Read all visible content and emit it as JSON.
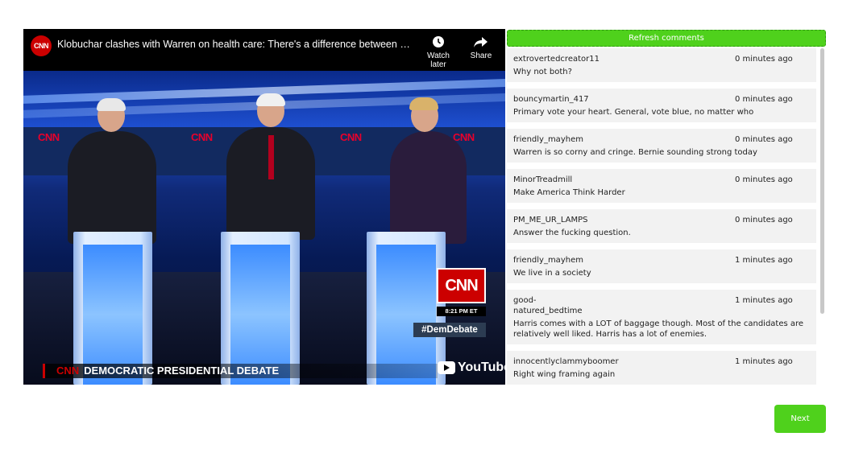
{
  "video": {
    "channel_logo": "CNN",
    "title": "Klobuchar clashes with Warren on health care: There's a difference between a pla...",
    "watch_later_label": "Watch later",
    "share_label": "Share",
    "watch_later_icon": "clock-icon",
    "share_icon": "share-arrow-icon",
    "overlay": {
      "cnn_bug": "CNN",
      "time": "8:21 PM ET",
      "lower_third_logo": "CNN",
      "lower_third": "DEMOCRATIC PRESIDENTIAL DEBATE",
      "hashtag": "#DemDebate",
      "youtube_logo": "YouTube"
    }
  },
  "comments_panel": {
    "refresh_label": "Refresh comments",
    "accent_color": "#4fd11c",
    "items": [
      {
        "user": "extrovertedcreator11",
        "time": "0 minutes ago",
        "text": "Why not both?"
      },
      {
        "user": "bouncymartin_417",
        "time": "0 minutes ago",
        "text": "Primary vote your heart. General, vote blue, no matter who"
      },
      {
        "user": "friendly_mayhem",
        "time": "0 minutes ago",
        "text": "Warren is so corny and cringe. Bernie sounding strong today"
      },
      {
        "user": "MinorTreadmill",
        "time": "0 minutes ago",
        "text": "Make America Think Harder"
      },
      {
        "user": "PM_ME_UR_LAMPS",
        "time": "0 minutes ago",
        "text": "Answer the fucking question."
      },
      {
        "user": "friendly_mayhem",
        "time": "1 minutes ago",
        "text": "We live in a society"
      },
      {
        "user": "good-\nnatured_bedtime",
        "time": "1 minutes ago",
        "text": "Harris comes with a LOT of baggage though. Most of the candidates are relatively well liked. Harris has a lot of enemies."
      },
      {
        "user": "innocentlyclammyboomer",
        "time": "1 minutes ago",
        "text": "Right wing framing again"
      }
    ]
  },
  "next_label": "Next"
}
